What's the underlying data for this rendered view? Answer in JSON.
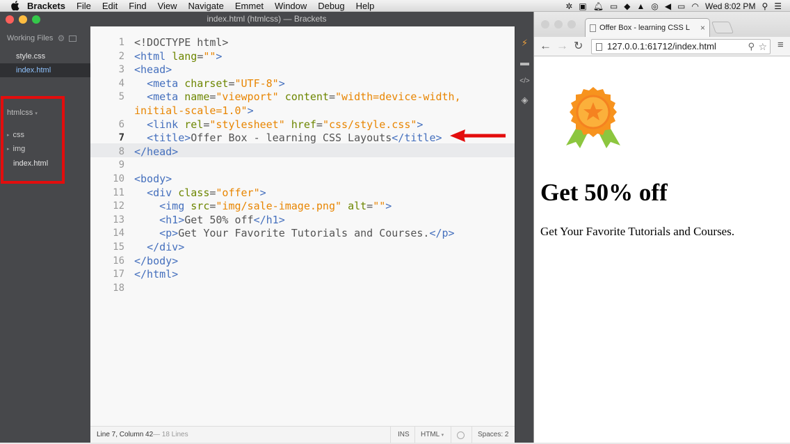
{
  "menubar": {
    "app": "Brackets",
    "items": [
      "File",
      "Edit",
      "Find",
      "View",
      "Navigate",
      "Emmet",
      "Window",
      "Debug",
      "Help"
    ],
    "clock": "Wed 8:02 PM"
  },
  "window": {
    "title": "index.html (htmlcss) — Brackets"
  },
  "sidebar": {
    "working_files_label": "Working Files",
    "working_files": [
      "style.css",
      "index.html"
    ],
    "project": "htmlcss",
    "tree": [
      {
        "label": "css",
        "type": "folder"
      },
      {
        "label": "img",
        "type": "folder"
      },
      {
        "label": "index.html",
        "type": "file"
      }
    ]
  },
  "editor": {
    "current_line": 7,
    "lines": [
      {
        "n": "1",
        "code": [
          [
            "d",
            "<!DOCTYPE html>"
          ]
        ]
      },
      {
        "n": "2",
        "code": [
          [
            "t",
            "<html "
          ],
          [
            "a",
            "lang"
          ],
          [
            "d",
            "="
          ],
          [
            "s",
            "\"\""
          ],
          [
            "t",
            ">"
          ]
        ]
      },
      {
        "n": "3",
        "code": [
          [
            "t",
            "<head>"
          ]
        ]
      },
      {
        "n": "4",
        "code": [
          [
            "d",
            "  "
          ],
          [
            "t",
            "<meta "
          ],
          [
            "a",
            "charset"
          ],
          [
            "d",
            "="
          ],
          [
            "s",
            "\"UTF-8\""
          ],
          [
            "t",
            ">"
          ]
        ]
      },
      {
        "n": "5",
        "code": [
          [
            "d",
            "  "
          ],
          [
            "t",
            "<meta "
          ],
          [
            "a",
            "name"
          ],
          [
            "d",
            "="
          ],
          [
            "s",
            "\"viewport\""
          ],
          [
            "d",
            " "
          ],
          [
            "a",
            "content"
          ],
          [
            "d",
            "="
          ],
          [
            "s",
            "\"width=device-width,"
          ]
        ]
      },
      {
        "n": "",
        "code": [
          [
            "s",
            "initial-scale=1.0\""
          ],
          [
            "t",
            ">"
          ]
        ]
      },
      {
        "n": "6",
        "code": [
          [
            "d",
            "  "
          ],
          [
            "t",
            "<link "
          ],
          [
            "a",
            "rel"
          ],
          [
            "d",
            "="
          ],
          [
            "s",
            "\"stylesheet\""
          ],
          [
            "d",
            " "
          ],
          [
            "a",
            "href"
          ],
          [
            "d",
            "="
          ],
          [
            "s",
            "\"css/style.css\""
          ],
          [
            "t",
            ">"
          ]
        ]
      },
      {
        "n": "7",
        "code": [
          [
            "d",
            "  "
          ],
          [
            "t",
            "<title>"
          ],
          [
            "d",
            "Offer Box - learning CSS Layouts"
          ],
          [
            "t",
            "</title>"
          ]
        ]
      },
      {
        "n": "8",
        "code": [
          [
            "t",
            "</head>"
          ]
        ]
      },
      {
        "n": "9",
        "code": []
      },
      {
        "n": "10",
        "code": [
          [
            "t",
            "<body>"
          ]
        ]
      },
      {
        "n": "11",
        "code": [
          [
            "d",
            "  "
          ],
          [
            "t",
            "<div "
          ],
          [
            "a",
            "class"
          ],
          [
            "d",
            "="
          ],
          [
            "s",
            "\"offer\""
          ],
          [
            "t",
            ">"
          ]
        ]
      },
      {
        "n": "12",
        "code": [
          [
            "d",
            "    "
          ],
          [
            "t",
            "<img "
          ],
          [
            "a",
            "src"
          ],
          [
            "d",
            "="
          ],
          [
            "s",
            "\"img/sale-image.png\""
          ],
          [
            "d",
            " "
          ],
          [
            "a",
            "alt"
          ],
          [
            "d",
            "="
          ],
          [
            "s",
            "\"\""
          ],
          [
            "t",
            ">"
          ]
        ]
      },
      {
        "n": "13",
        "code": [
          [
            "d",
            "    "
          ],
          [
            "t",
            "<h1>"
          ],
          [
            "d",
            "Get 50% off"
          ],
          [
            "t",
            "</h1>"
          ]
        ]
      },
      {
        "n": "14",
        "code": [
          [
            "d",
            "    "
          ],
          [
            "t",
            "<p>"
          ],
          [
            "d",
            "Get Your Favorite Tutorials and Courses."
          ],
          [
            "t",
            "</p>"
          ]
        ]
      },
      {
        "n": "15",
        "code": [
          [
            "d",
            "  "
          ],
          [
            "t",
            "</div>"
          ]
        ]
      },
      {
        "n": "16",
        "code": [
          [
            "t",
            "</body>"
          ]
        ]
      },
      {
        "n": "17",
        "code": [
          [
            "t",
            "</html>"
          ]
        ]
      },
      {
        "n": "18",
        "code": []
      }
    ]
  },
  "statusbar": {
    "position": "Line 7, Column 42",
    "lines": "— 18 Lines",
    "mode": "INS",
    "language": "HTML",
    "spaces": "Spaces:  2"
  },
  "browser": {
    "tab_title": "Offer Box - learning CSS L",
    "url": "127.0.0.1:61712/index.html",
    "h1": "Get 50% off",
    "p": "Get Your Favorite Tutorials and Courses."
  },
  "colors": {
    "tag": "#446fbd",
    "attr": "#6d8600",
    "string": "#e88501",
    "highlight": "#e30d0d"
  }
}
